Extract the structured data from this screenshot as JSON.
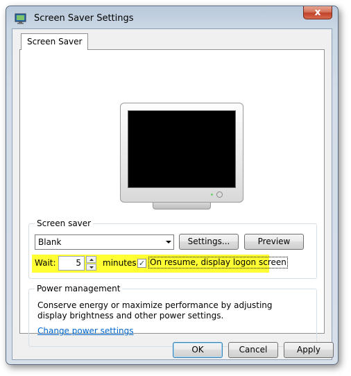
{
  "window": {
    "title": "Screen Saver Settings",
    "close_glyph": "x"
  },
  "tabs": [
    {
      "label": "Screen Saver"
    }
  ],
  "screen_saver_group": {
    "label": "Screen saver",
    "dropdown_value": "Blank",
    "settings_button": "Settings...",
    "preview_button": "Preview",
    "wait_label": "Wait:",
    "wait_value": "5",
    "minutes_label": "minutes",
    "resume_checkbox_checked": true,
    "resume_checkbox_label": "On resume, display logon screen",
    "highlight_color": "#ffff33"
  },
  "power_group": {
    "label": "Power management",
    "description": "Conserve energy or maximize performance by adjusting display brightness and other power settings.",
    "link": "Change power settings"
  },
  "footer": {
    "ok_button": "OK",
    "cancel_button": "Cancel",
    "apply_button": "Apply"
  },
  "icons": [
    "screen-saver-app-icon",
    "close-icon",
    "dropdown-arrow-icon",
    "spin-up-icon",
    "spin-down-icon",
    "checkmark-icon",
    "monitor-preview"
  ]
}
